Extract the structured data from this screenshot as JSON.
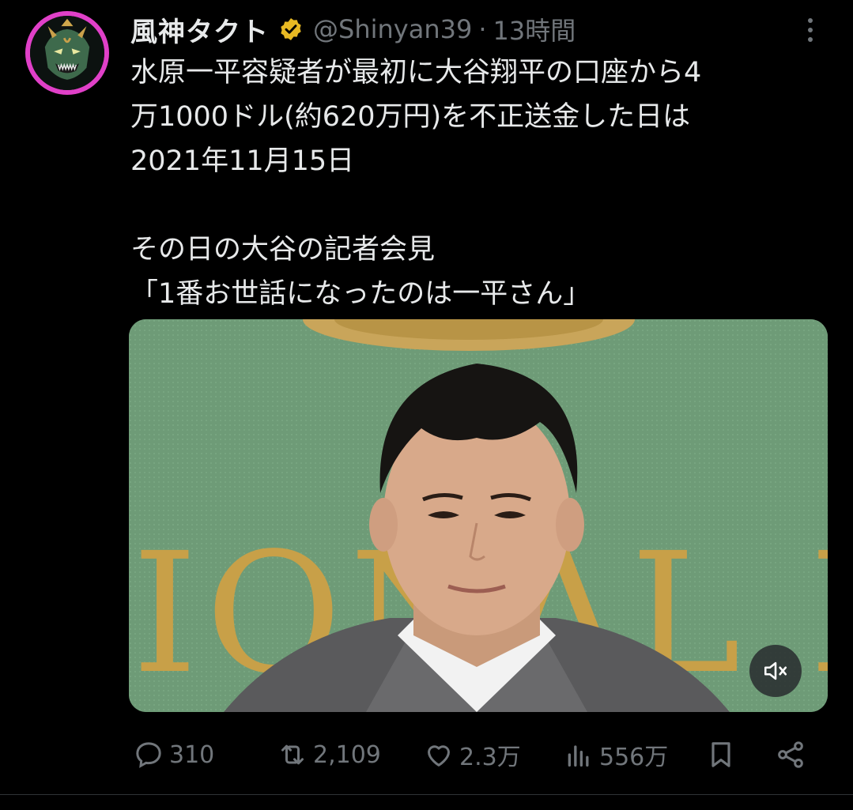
{
  "tweet": {
    "display_name": "風神タクト",
    "handle": "@Shinyan39",
    "separator": "·",
    "timestamp": "13時間",
    "body_lines": [
      "水原一平容疑者が最初に大谷翔平の口座から4",
      "万1000ドル(約620万円)を不正送金した日は",
      "2021年11月15日",
      "",
      "その日の大谷の記者会見",
      "「1番お世話になったのは一平さん」"
    ],
    "media": {
      "overlay_text": "IONAL P",
      "icons": {
        "mute": "volume-mute-icon"
      }
    },
    "actions": {
      "reply_count": "310",
      "retweet_count": "2,109",
      "like_count": "2.3万",
      "view_count": "556万"
    }
  },
  "icons": {
    "verified": "verified-badge-icon",
    "more": "more-vertical-icon",
    "reply": "reply-icon",
    "retweet": "retweet-icon",
    "like": "heart-icon",
    "views": "views-chart-icon",
    "bookmark": "bookmark-icon",
    "share": "share-icon"
  },
  "colors": {
    "background": "#000000",
    "text": "#e7e9ea",
    "muted": "#71767b",
    "verified": "#e8b923",
    "avatar_ring": "#e040c8"
  }
}
